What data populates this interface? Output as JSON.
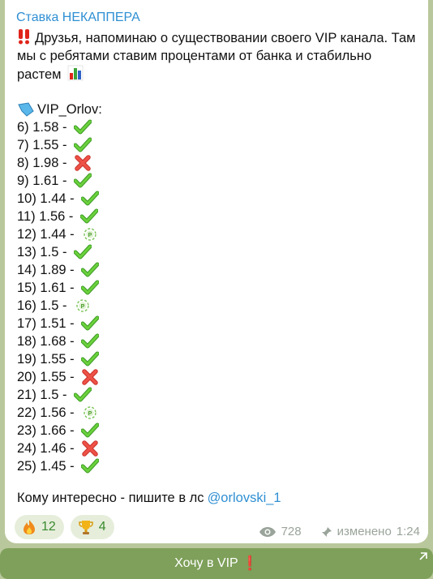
{
  "channel_name": "Ставка НЕКАППЕРА",
  "intro_text": "Друзья, напоминаю о существовании своего VIP канала. Там мы с ребятами ставим процентами от банка и стабильно растем",
  "vip_label": "VIP_Orlov:",
  "results": [
    {
      "label": "6) 1.58 - ",
      "status": "win"
    },
    {
      "label": "7) 1.55 - ",
      "status": "win"
    },
    {
      "label": "8) 1.98 - ",
      "status": "loss"
    },
    {
      "label": "9) 1.61 - ",
      "status": "win"
    },
    {
      "label": "10) 1.44 - ",
      "status": "win"
    },
    {
      "label": "11) 1.56 - ",
      "status": "win"
    },
    {
      "label": "12) 1.44 - ",
      "status": "refund"
    },
    {
      "label": "13) 1.5 - ",
      "status": "win"
    },
    {
      "label": "14) 1.89 - ",
      "status": "win"
    },
    {
      "label": "15) 1.61 - ",
      "status": "win"
    },
    {
      "label": "16) 1.5 - ",
      "status": "refund"
    },
    {
      "label": "17) 1.51 - ",
      "status": "win"
    },
    {
      "label": "18) 1.68 - ",
      "status": "win"
    },
    {
      "label": "19) 1.55 - ",
      "status": "win"
    },
    {
      "label": "20) 1.55 - ",
      "status": "loss"
    },
    {
      "label": "21) 1.5 - ",
      "status": "win"
    },
    {
      "label": "22) 1.56 - ",
      "status": "refund"
    },
    {
      "label": "23) 1.66 - ",
      "status": "win"
    },
    {
      "label": "24) 1.46 - ",
      "status": "loss"
    },
    {
      "label": "25) 1.45 - ",
      "status": "win"
    }
  ],
  "closing_text": "Кому интересно - пишите в лс",
  "mention": "@orlovski_1",
  "reactions": [
    {
      "icon": "fire-icon",
      "count": "12"
    },
    {
      "icon": "trophy-icon",
      "count": "4"
    }
  ],
  "views": "728",
  "edited_label": "изменено",
  "time": "1:24",
  "button_label": "Хочу в VIP",
  "colors": {
    "link": "#2f8fd3",
    "button": "#7ea05a",
    "check": "#5cc234",
    "cross": "#e8453c",
    "background": "#b9c79c"
  }
}
